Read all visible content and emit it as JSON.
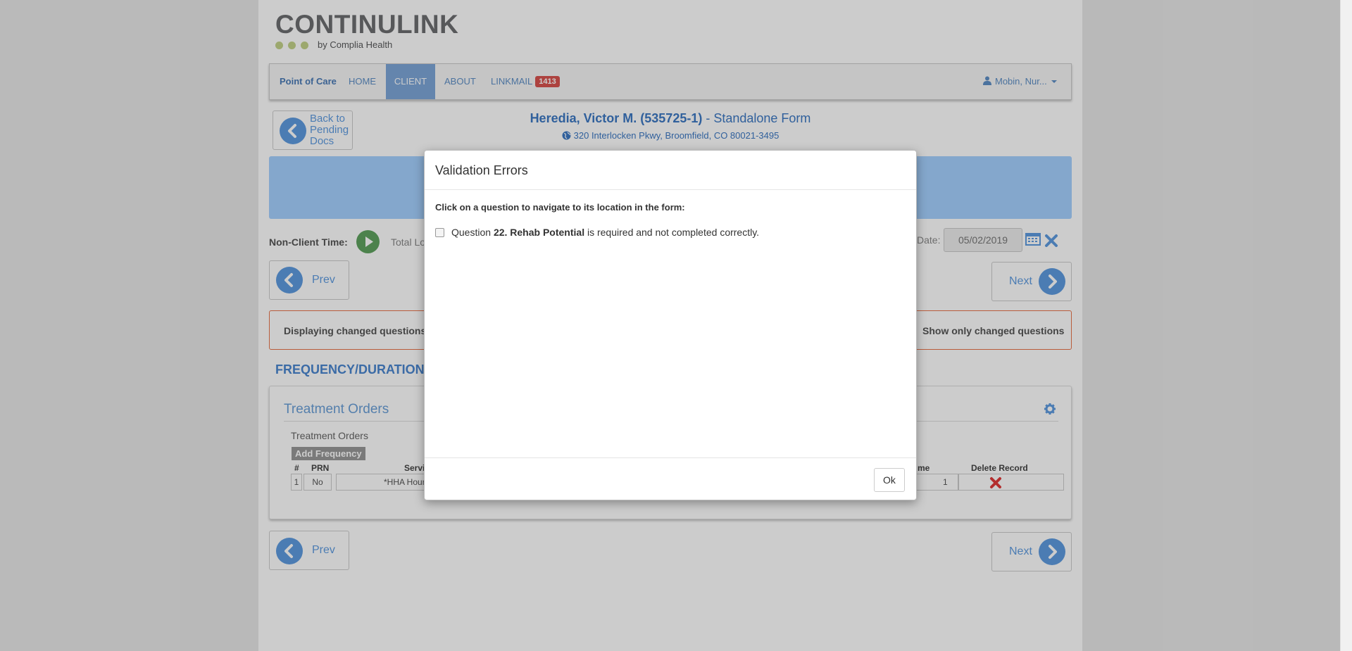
{
  "logo": {
    "word": "CONTINULINK",
    "sub": "by Complia Health"
  },
  "navbar": {
    "brand": "Point of Care",
    "home": "HOME",
    "client": "CLIENT",
    "about": "ABOUT",
    "linkmail": "LINKMAIL",
    "linkmail_badge": "1413",
    "user": "Mobin, Nur..."
  },
  "back_button": {
    "label": "Back to Pending Docs"
  },
  "patient": {
    "name": "Heredia, Victor M. (535725-1)",
    "separator": " - ",
    "form": "Standalone Form",
    "address": "320 Interlocken Pkwy, Broomfield, CO 80021-3495"
  },
  "toolbar": {
    "nonclient_label": "Non-Client Time:",
    "total_label": "Total Lo",
    "date_label": "Date:",
    "date_value": "05/02/2019"
  },
  "pager": {
    "prev": "Prev",
    "next": "Next"
  },
  "changed": {
    "text": "Displaying changed questions i",
    "checkbox_label": "Show only changed questions"
  },
  "section": {
    "title": "FREQUENCY/DURATION"
  },
  "panel": {
    "title": "Treatment Orders",
    "subtitle": "Treatment Orders",
    "add_button": "Add Frequency",
    "headers": {
      "num": "#",
      "prn": "PRN",
      "service": "Servi",
      "time": "me",
      "delete": "Delete Record"
    },
    "row": {
      "num": "1",
      "prn": "No",
      "service": "*HHA Hour",
      "time": "1"
    }
  },
  "modal": {
    "title": "Validation Errors",
    "instruction": "Click on a question to navigate to its location in the form:",
    "question_prefix": "Question",
    "question_name": "22. Rehab Potential",
    "question_suffix": "is required and not completed correctly.",
    "ok": "Ok"
  },
  "colors": {
    "accent": "#5e9be0",
    "banner": "#a5d1ff",
    "badge": "#d9534f",
    "warning_border": "#e8734a"
  }
}
